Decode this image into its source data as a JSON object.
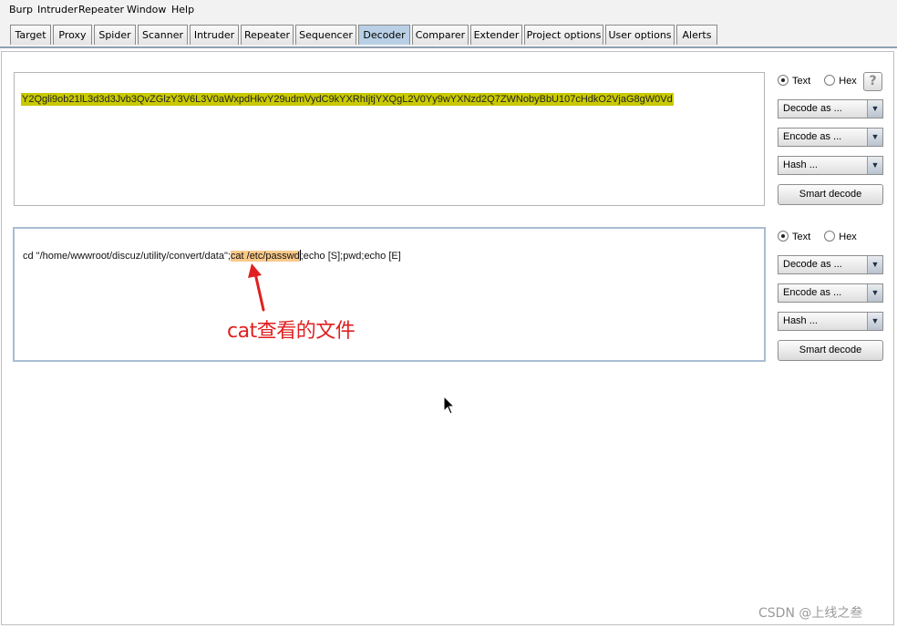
{
  "menu": [
    "Burp",
    "Intruder",
    "Repeater",
    "Window",
    "Help"
  ],
  "tabs": [
    "Target",
    "Proxy",
    "Spider",
    "Scanner",
    "Intruder",
    "Repeater",
    "Sequencer",
    "Decoder",
    "Comparer",
    "Extender",
    "Project options",
    "User options",
    "Alerts"
  ],
  "active_tab": "Decoder",
  "pane1": {
    "content": "Y2Qgli9ob21lL3d3d3Jvb3QvZGlzY3V6L3V0aWxpdHkvY29udmVydC9kYXRhIjtjYXQgL2V0Yy9wYXNzd2Q7ZWNobyBbU107cHdkO2VjaG8gW0Vd"
  },
  "pane2": {
    "before": "cd \"/home/wwwroot/discuz/utility/convert/data\";",
    "highlight": "cat /etc/passwd",
    "after": ";echo [S];pwd;echo [E]"
  },
  "annotation": "cat查看的文件",
  "controls": {
    "text_label": "Text",
    "hex_label": "Hex",
    "help_label": "?",
    "decode_label": "Decode as ...",
    "encode_label": "Encode as ...",
    "hash_label": "Hash ...",
    "smart_label": "Smart decode"
  },
  "watermark": "CSDN @上线之叁",
  "colors": {
    "encoded_highlight": "#c9c900",
    "selection_highlight": "#f9c98a",
    "annotation": "#e02020",
    "active_tab": "#b8cfe5"
  }
}
